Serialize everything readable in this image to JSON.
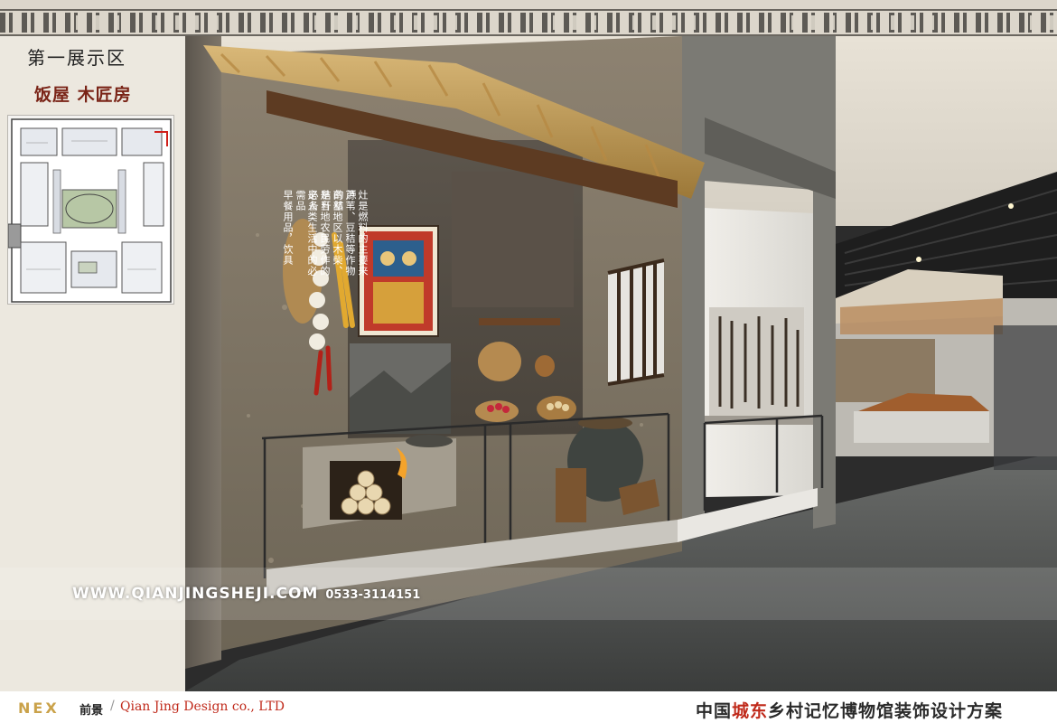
{
  "header": {
    "section_title": "第一展示区",
    "section_subtitle": "饭屋 木匠房"
  },
  "panel_text": {
    "col1": "早餐用品，饮具",
    "col2": "是人类生活中的必需品",
    "col3": "是当地农民劳作的必备",
    "col4": "南部地区以木柴、秸秆",
    "col5": "芦苇、豆秸等作物的秸",
    "col6": "灶是燃料的主要来源"
  },
  "watermark": {
    "url": "WWW.QIANJINGSHEJI.COM",
    "phone": "0533-3114151"
  },
  "footer": {
    "logo": "NEX",
    "logo_cn": "前景",
    "company": "Qian Jing Design co., LTD",
    "title_part1": "中国",
    "title_highlight": "城东",
    "title_part2": "乡村记忆博物馆",
    "title_part3": "装饰设计方案"
  },
  "colors": {
    "accent_red": "#c02a1b",
    "title_dark_red": "#7a2417",
    "logo_gold": "#caa24a"
  }
}
